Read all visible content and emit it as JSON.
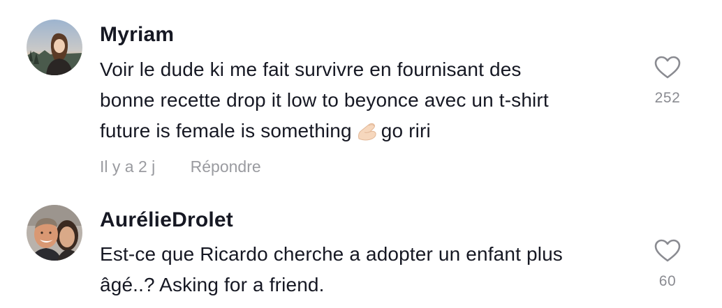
{
  "comments": [
    {
      "username": "Myriam",
      "text_lines": [
        "Voir le dude ki me fait survivre en fournisant des",
        "bonne recette drop it low to beyonce avec un t-shirt",
        "future is female is something"
      ],
      "text_tail": "go riri",
      "emoji_icon": "pinched-fingers-emoji",
      "time": "Il y a 2 j",
      "reply_label": "Répondre",
      "likes": "252"
    },
    {
      "username": "AurélieDrolet",
      "text_lines": [
        "Est-ce que Ricardo cherche a adopter un enfant plus",
        "âgé..? Asking for a friend."
      ],
      "likes": "60"
    }
  ],
  "colors": {
    "text": "#161823",
    "secondary": "#9a9ba0",
    "heart_outline": "#8a8b91"
  }
}
